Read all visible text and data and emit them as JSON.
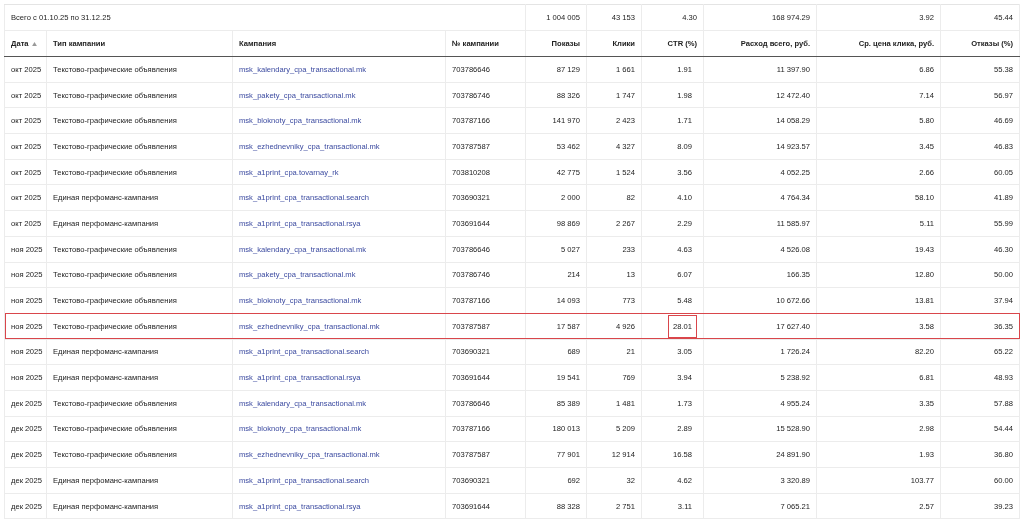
{
  "totals": {
    "label": "Всего с 01.10.25 по 31.12.25",
    "values": [
      "1 004 005",
      "43 153",
      "4.30",
      "168 974.29",
      "3.92",
      "45.44"
    ]
  },
  "table": {
    "columns": [
      {
        "label": "Дата",
        "sorted": true
      },
      {
        "label": "Тип кампании",
        "sorted": false
      },
      {
        "label": "Кампания",
        "sorted": false
      },
      {
        "label": "№ кампании",
        "sorted": false
      },
      {
        "label": "Показы",
        "sorted": false
      },
      {
        "label": "Клики",
        "sorted": false
      },
      {
        "label": "CTR (%)",
        "sorted": false
      },
      {
        "label": "Расход всего, руб.",
        "sorted": false
      },
      {
        "label": "Ср. цена клика, руб.",
        "sorted": false
      },
      {
        "label": "Отказы (%)",
        "sorted": false
      }
    ],
    "rows": [
      {
        "highlighted": false,
        "ctr_highlighted": false,
        "cells": [
          "окт 2025",
          "Текстово-графические объявления",
          "msk_kalendary_cpa_transactional.mk",
          "703786646",
          "87 129",
          "1 661",
          "1.91",
          "11 397.90",
          "6.86",
          "55.38"
        ]
      },
      {
        "highlighted": false,
        "ctr_highlighted": false,
        "cells": [
          "окт 2025",
          "Текстово-графические объявления",
          "msk_pakety_cpa_transactional.mk",
          "703786746",
          "88 326",
          "1 747",
          "1.98",
          "12 472.40",
          "7.14",
          "56.97"
        ]
      },
      {
        "highlighted": false,
        "ctr_highlighted": false,
        "cells": [
          "окт 2025",
          "Текстово-графические объявления",
          "msk_bloknoty_cpa_transactional.mk",
          "703787166",
          "141 970",
          "2 423",
          "1.71",
          "14 058.29",
          "5.80",
          "46.69"
        ]
      },
      {
        "highlighted": false,
        "ctr_highlighted": false,
        "cells": [
          "окт 2025",
          "Текстово-графические объявления",
          "msk_ezhednevniky_cpa_transactional.mk",
          "703787587",
          "53 462",
          "4 327",
          "8.09",
          "14 923.57",
          "3.45",
          "46.83"
        ]
      },
      {
        "highlighted": false,
        "ctr_highlighted": false,
        "cells": [
          "окт 2025",
          "Текстово-графические объявления",
          "msk_a1print_cpa.tovarnay_rk",
          "703810208",
          "42 775",
          "1 524",
          "3.56",
          "4 052.25",
          "2.66",
          "60.05"
        ]
      },
      {
        "highlighted": false,
        "ctr_highlighted": false,
        "cells": [
          "окт 2025",
          "Единая перфоманс-кампания",
          "msk_a1print_cpa_transactional.search",
          "703690321",
          "2 000",
          "82",
          "4.10",
          "4 764.34",
          "58.10",
          "41.89"
        ]
      },
      {
        "highlighted": false,
        "ctr_highlighted": false,
        "cells": [
          "окт 2025",
          "Единая перфоманс-кампания",
          "msk_a1print_cpa_transactional.rsya",
          "703691644",
          "98 869",
          "2 267",
          "2.29",
          "11 585.97",
          "5.11",
          "55.99"
        ]
      },
      {
        "highlighted": false,
        "ctr_highlighted": false,
        "cells": [
          "ноя 2025",
          "Текстово-графические объявления",
          "msk_kalendary_cpa_transactional.mk",
          "703786646",
          "5 027",
          "233",
          "4.63",
          "4 526.08",
          "19.43",
          "46.30"
        ]
      },
      {
        "highlighted": false,
        "ctr_highlighted": false,
        "cells": [
          "ноя 2025",
          "Текстово-графические объявления",
          "msk_pakety_cpa_transactional.mk",
          "703786746",
          "214",
          "13",
          "6.07",
          "166.35",
          "12.80",
          "50.00"
        ]
      },
      {
        "highlighted": false,
        "ctr_highlighted": false,
        "cells": [
          "ноя 2025",
          "Текстово-графические объявления",
          "msk_bloknoty_cpa_transactional.mk",
          "703787166",
          "14 093",
          "773",
          "5.48",
          "10 672.66",
          "13.81",
          "37.94"
        ]
      },
      {
        "highlighted": true,
        "ctr_highlighted": true,
        "cells": [
          "ноя 2025",
          "Текстово-графические объявления",
          "msk_ezhednevniky_cpa_transactional.mk",
          "703787587",
          "17 587",
          "4 926",
          "28.01",
          "17 627.40",
          "3.58",
          "36.35"
        ]
      },
      {
        "highlighted": false,
        "ctr_highlighted": false,
        "cells": [
          "ноя 2025",
          "Единая перфоманс-кампания",
          "msk_a1print_cpa_transactional.search",
          "703690321",
          "689",
          "21",
          "3.05",
          "1 726.24",
          "82.20",
          "65.22"
        ]
      },
      {
        "highlighted": false,
        "ctr_highlighted": false,
        "cells": [
          "ноя 2025",
          "Единая перфоманс-кампания",
          "msk_a1print_cpa_transactional.rsya",
          "703691644",
          "19 541",
          "769",
          "3.94",
          "5 238.92",
          "6.81",
          "48.93"
        ]
      },
      {
        "highlighted": false,
        "ctr_highlighted": false,
        "cells": [
          "дек 2025",
          "Текстово-графические объявления",
          "msk_kalendary_cpa_transactional.mk",
          "703786646",
          "85 389",
          "1 481",
          "1.73",
          "4 955.24",
          "3.35",
          "57.88"
        ]
      },
      {
        "highlighted": false,
        "ctr_highlighted": false,
        "cells": [
          "дек 2025",
          "Текстово-графические объявления",
          "msk_bloknoty_cpa_transactional.mk",
          "703787166",
          "180 013",
          "5 209",
          "2.89",
          "15 528.90",
          "2.98",
          "54.44"
        ]
      },
      {
        "highlighted": false,
        "ctr_highlighted": false,
        "cells": [
          "дек 2025",
          "Текстово-графические объявления",
          "msk_ezhednevniky_cpa_transactional.mk",
          "703787587",
          "77 901",
          "12 914",
          "16.58",
          "24 891.90",
          "1.93",
          "36.80"
        ]
      },
      {
        "highlighted": false,
        "ctr_highlighted": false,
        "cells": [
          "дек 2025",
          "Единая перфоманс-кампания",
          "msk_a1print_cpa_transactional.search",
          "703690321",
          "692",
          "32",
          "4.62",
          "3 320.89",
          "103.77",
          "60.00"
        ]
      },
      {
        "highlighted": false,
        "ctr_highlighted": false,
        "cells": [
          "дек 2025",
          "Единая перфоманс-кампания",
          "msk_a1print_cpa_transactional.rsya",
          "703691644",
          "88 328",
          "2 751",
          "3.11",
          "7 065.21",
          "2.57",
          "39.23"
        ]
      }
    ]
  }
}
